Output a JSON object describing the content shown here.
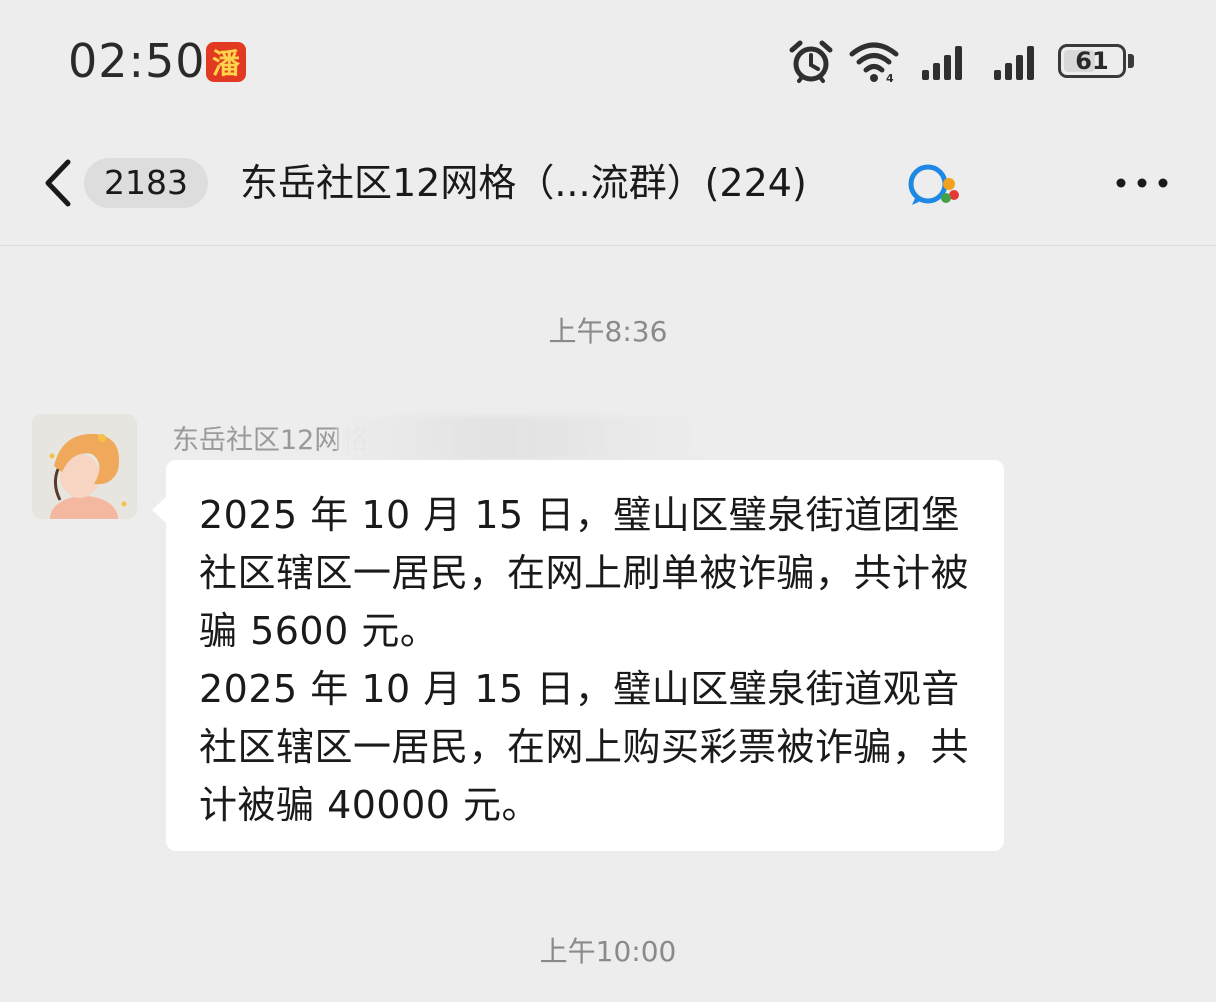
{
  "status_bar": {
    "time": "02:50",
    "app_badge": "潘",
    "battery": "61",
    "battery_level": 0.61,
    "icons": [
      "alarm-icon",
      "wifi-icon",
      "signal-icon",
      "signal-icon",
      "battery-icon"
    ]
  },
  "nav": {
    "unread_count": "2183",
    "title": "东岳社区12网格（...流群）(224)",
    "icons": [
      "back-chevron-icon",
      "chat-bubble-icon",
      "more-icon"
    ]
  },
  "messages": [
    {
      "timestamp": "上午8:36",
      "sender": "东岳社区12网格",
      "paragraphs": [
        "2025 年 10 月 15 日，璧山区璧泉街道团堡社区辖区一居民，在网上刷单被诈骗，共计被骗 5600 元。",
        "2025 年 10 月 15 日，璧山区璧泉街道观音社区辖区一居民，在网上购买彩票被诈骗，共计被骗 40000 元。"
      ]
    }
  ],
  "next_timestamp": "上午10:00",
  "colors": {
    "background": "#ededed",
    "bubble": "#ffffff",
    "badge": "#e23a22"
  }
}
